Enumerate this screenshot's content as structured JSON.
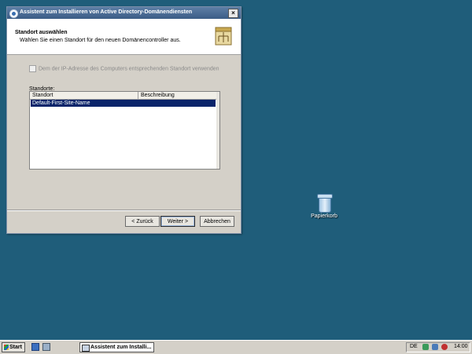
{
  "window": {
    "title": "Assistent zum Installieren von Active Directory-Domänendiensten",
    "close_glyph": "×",
    "header": {
      "title": "Standort auswählen",
      "subtitle": "Wählen Sie einen Standort für den neuen Domänencontroller aus."
    },
    "checkbox_label": "Dem der IP-Adresse des Computers entsprechenden Standort verwenden",
    "sites_label": "Standorte:",
    "list": {
      "columns": [
        "Standort",
        "Beschreibung"
      ],
      "rows": [
        {
          "site": "Default-First-Site-Name",
          "description": ""
        }
      ]
    },
    "buttons": {
      "back": "< Zurück",
      "next": "Weiter >",
      "cancel": "Abbrechen"
    }
  },
  "desktop": {
    "icons": [
      {
        "label": "Papierkorb",
        "icon": "recycle-bin-icon"
      }
    ]
  },
  "taskbar": {
    "start_label": "Start",
    "task_label": "Assistent zum Installi...",
    "language": "DE",
    "clock": "14:00"
  },
  "colors": {
    "desktop": "#1f5d7a",
    "selection": "#0a246a",
    "titlebar": "#3b5c86"
  }
}
